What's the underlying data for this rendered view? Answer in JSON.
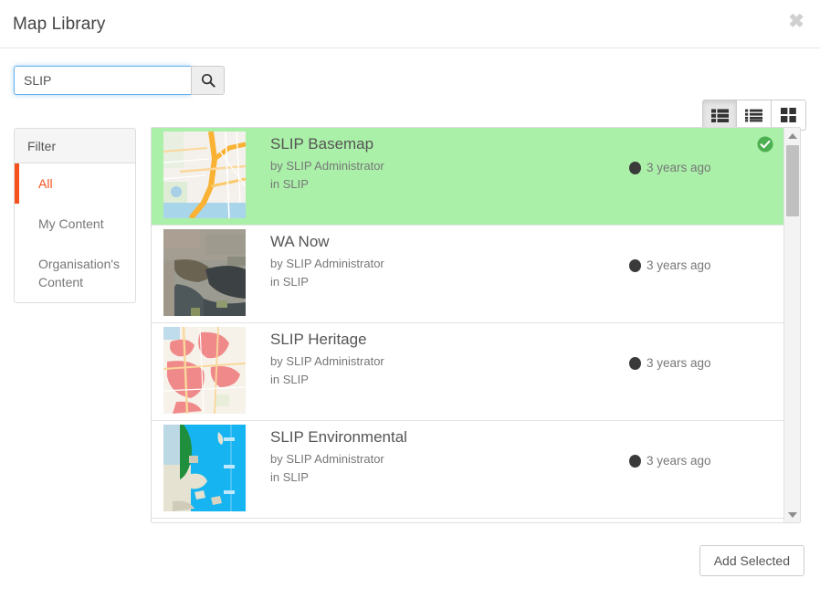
{
  "header": {
    "title": "Map Library",
    "close_label": "✖"
  },
  "search": {
    "value": "SLIP",
    "placeholder": "Search",
    "button_icon": "search-icon"
  },
  "view_toggle": {
    "options": [
      {
        "id": "list-large",
        "icon": "list-large-icon",
        "active": true
      },
      {
        "id": "list-compact",
        "icon": "list-compact-icon",
        "active": false
      },
      {
        "id": "grid",
        "icon": "grid-icon",
        "active": false
      }
    ]
  },
  "filter": {
    "header": "Filter",
    "items": [
      {
        "label": "All",
        "active": true
      },
      {
        "label": "My Content",
        "active": false
      },
      {
        "label": "Organisation's Content",
        "active": false
      }
    ],
    "active_color": "#f4511e"
  },
  "list": {
    "items": [
      {
        "title": "SLIP Basemap",
        "author": "by SLIP Administrator",
        "location": "in SLIP",
        "modified": "3 years ago",
        "selected": true,
        "thumb_type": "roadmap"
      },
      {
        "title": "WA Now",
        "author": "by SLIP Administrator",
        "location": "in SLIP",
        "modified": "3 years ago",
        "selected": false,
        "thumb_type": "satellite"
      },
      {
        "title": "SLIP Heritage",
        "author": "by SLIP Administrator",
        "location": "in SLIP",
        "modified": "3 years ago",
        "selected": false,
        "thumb_type": "heritage"
      },
      {
        "title": "SLIP Environmental",
        "author": "by SLIP Administrator",
        "location": "in SLIP",
        "modified": "3 years ago",
        "selected": false,
        "thumb_type": "environmental"
      }
    ],
    "selected_bg": "#aaf0a8",
    "check_badge_color": "#4caf50"
  },
  "footer": {
    "add_button": "Add Selected"
  }
}
